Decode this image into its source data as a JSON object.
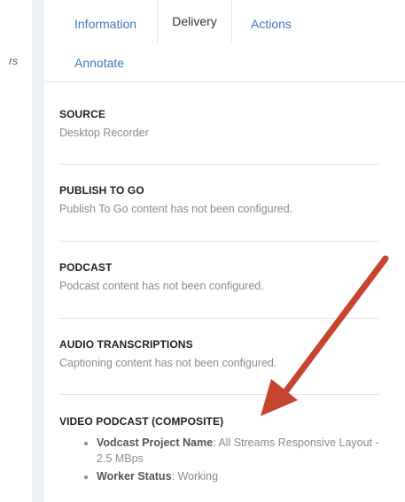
{
  "left_cut_text": "rs",
  "tabs": [
    "Information",
    "Delivery",
    "Actions",
    "Annotate"
  ],
  "sections": [
    {
      "heading": "SOURCE",
      "text": "Desktop Recorder"
    },
    {
      "heading": "PUBLISH TO GO",
      "text": "Publish To Go content has not been configured."
    },
    {
      "heading": "PODCAST",
      "text": "Podcast content has not been configured."
    },
    {
      "heading": "AUDIO TRANSCRIPTIONS",
      "text": "Captioning content has not been configured."
    },
    {
      "heading": "VIDEO PODCAST (COMPOSITE)"
    }
  ],
  "video_podcast_items": [
    {
      "key": "Vodcast Project Name",
      "value": ": All Streams Responsive Layout - 2.5 MBps"
    },
    {
      "key": "Worker Status",
      "value": ": Working"
    }
  ],
  "colors": {
    "tab_link": "#3d7ab8",
    "arrow": "#c5452f",
    "muted_text": "#8a8a8a"
  }
}
